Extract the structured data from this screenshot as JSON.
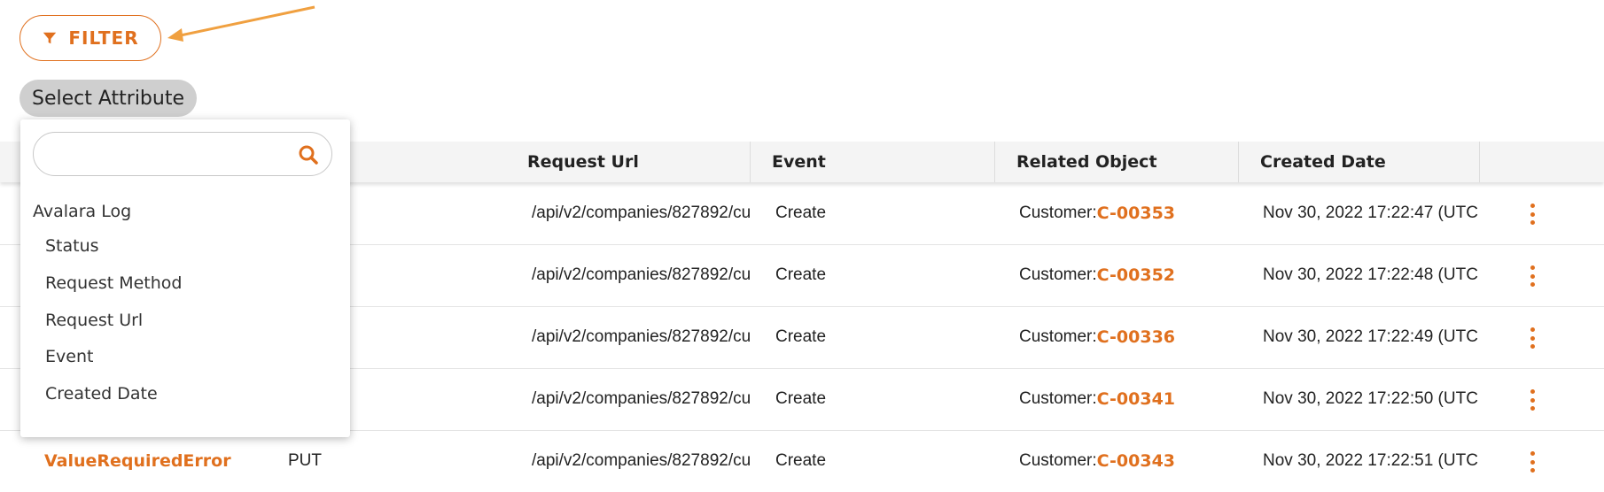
{
  "filter": {
    "label": "FILTER",
    "icon": "funnel-icon",
    "color": "#e0701e"
  },
  "chip": {
    "label": "Select Attribute"
  },
  "table": {
    "columns": [
      "Status",
      "Request Method",
      "Request Url",
      "Event",
      "Related Object",
      "Created Date"
    ],
    "visible_headers": [
      "Request Url",
      "Event",
      "Related Object",
      "Created Date"
    ],
    "rows": [
      {
        "status": "",
        "method": "",
        "url": "/api/v2/companies/827892/cu",
        "event": "Create",
        "object_prefix": "Customer:",
        "object_id": "C-00353",
        "date": "Nov 30, 2022 17:22:47 (UTC"
      },
      {
        "status": "",
        "method": "",
        "url": "/api/v2/companies/827892/cu",
        "event": "Create",
        "object_prefix": "Customer:",
        "object_id": "C-00352",
        "date": "Nov 30, 2022 17:22:48 (UTC"
      },
      {
        "status": "",
        "method": "",
        "url": "/api/v2/companies/827892/cu",
        "event": "Create",
        "object_prefix": "Customer:",
        "object_id": "C-00336",
        "date": "Nov 30, 2022 17:22:49 (UTC"
      },
      {
        "status": "",
        "method": "",
        "url": "/api/v2/companies/827892/cu",
        "event": "Create",
        "object_prefix": "Customer:",
        "object_id": "C-00341",
        "date": "Nov 30, 2022 17:22:50 (UTC"
      },
      {
        "status": "ValueRequiredError",
        "method": "PUT",
        "url": "/api/v2/companies/827892/cu",
        "event": "Create",
        "object_prefix": "Customer:",
        "object_id": "C-00343",
        "date": "Nov 30, 2022 17:22:51 (UTC"
      }
    ]
  },
  "dropdown": {
    "search_value": "",
    "group": "Avalara Log",
    "options": [
      "Status",
      "Request Method",
      "Request Url",
      "Event",
      "Created Date"
    ]
  }
}
